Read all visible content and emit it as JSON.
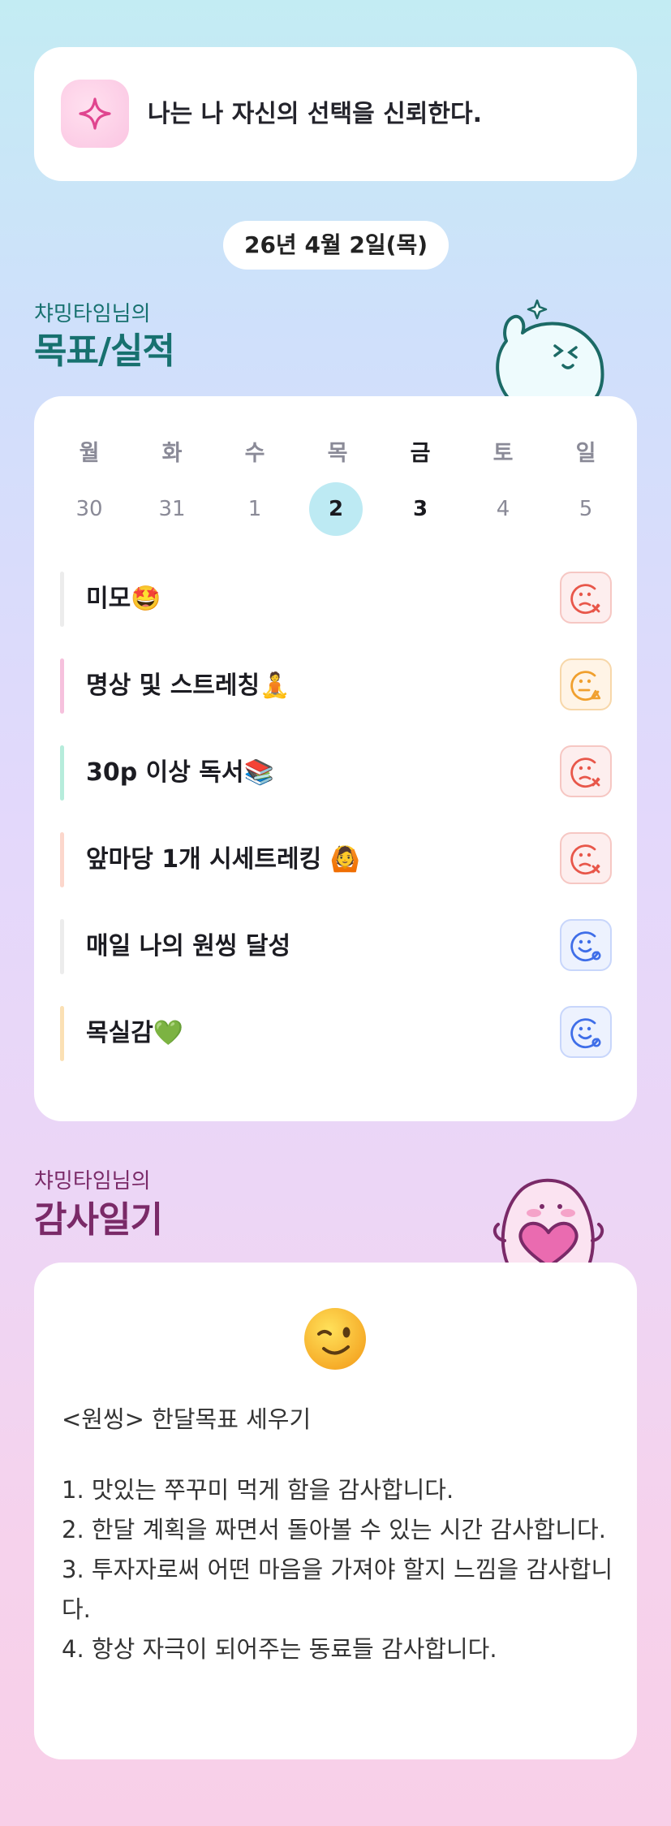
{
  "affirmation": {
    "icon": "sparkle-icon",
    "text": "나는 나 자신의 선택을 신뢰한다."
  },
  "date_label": "26년 4월 2일(목)",
  "goals_section": {
    "subtitle": "챠밍타임님의",
    "title": "목표/실적"
  },
  "week": {
    "days": [
      "월",
      "화",
      "수",
      "목",
      "금",
      "토",
      "일"
    ],
    "dates": [
      "30",
      "31",
      "1",
      "2",
      "3",
      "4",
      "5"
    ],
    "selected_index": 3,
    "today_index": 4
  },
  "goals": [
    {
      "label": "미모🤩",
      "status": "fail",
      "bar_color": "#ececec"
    },
    {
      "label": "명상 및 스트레칭🧘",
      "status": "partial",
      "bar_color": "#f6c1dd"
    },
    {
      "label": "30p 이상 독서📚",
      "status": "fail",
      "bar_color": "#b6ecdb"
    },
    {
      "label": "앞마당 1개 시세트레킹 🙆",
      "status": "fail",
      "bar_color": "#fcd7cc"
    },
    {
      "label": "매일 나의 원씽 달성",
      "status": "success",
      "bar_color": "#ececec"
    },
    {
      "label": "목실감💚",
      "status": "success",
      "bar_color": "#fbe0b4"
    }
  ],
  "colors": {
    "fail": "#e8574a",
    "partial": "#f0a02e",
    "success": "#3f6ee8",
    "goals_title": "#17716f",
    "gratitude_title": "#7a2a68"
  },
  "gratitude_section": {
    "subtitle": "챠밍타임님의",
    "title": "감사일기"
  },
  "gratitude": {
    "emoji": "winking-face",
    "heading": "<원씽> 한달목표 세우기",
    "lines": [
      "1. 맛있는 쭈꾸미 먹게 함을 감사합니다.",
      "2. 한달 계획을 짜면서 돌아볼 수 있는 시간 감사합니다.",
      "3. 투자자로써 어떤 마음을 가져야 할지 느낌을 감사합니다.",
      "4. 항상 자극이 되어주는 동료들 감사합니다."
    ]
  }
}
